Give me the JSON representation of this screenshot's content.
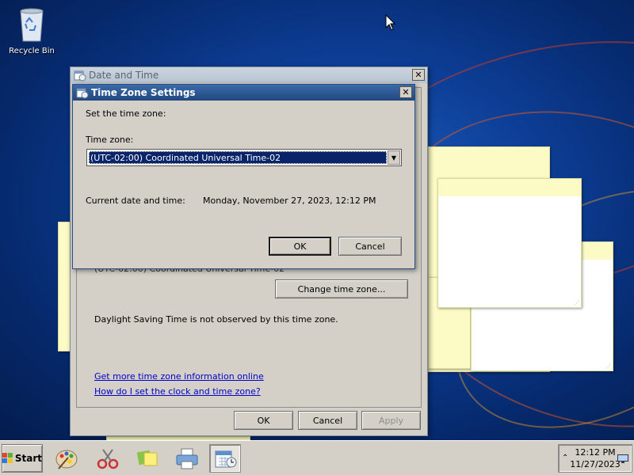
{
  "desktop": {
    "recycle_bin_label": "Recycle Bin"
  },
  "date_time_window": {
    "title": "Date and Time",
    "timezone_text": "(UTC-02:00) Coordinated Universal Time-02",
    "change_tz_button": "Change time zone...",
    "dst_text": "Daylight Saving Time is not observed by this time zone.",
    "link_more_info": "Get more time zone information online",
    "link_how_to": "How do I set the clock and time zone?",
    "ok_button": "OK",
    "cancel_button": "Cancel",
    "apply_button": "Apply"
  },
  "tz_dialog": {
    "title": "Time Zone Settings",
    "set_label": "Set the time zone:",
    "tz_label": "Time zone:",
    "tz_selected": "(UTC-02:00) Coordinated Universal Time-02",
    "current_label": "Current date and time:",
    "current_value": "Monday, November 27, 2023, 12:12 PM",
    "ok_button": "OK",
    "cancel_button": "Cancel"
  },
  "taskbar": {
    "start_label": "Start",
    "clock_time": "12:12 PM",
    "clock_date": "11/27/2023",
    "apps": [
      "paint-icon",
      "snipping-tool-icon",
      "sticky-notes-icon",
      "printer-icon",
      "date-time-icon"
    ]
  }
}
